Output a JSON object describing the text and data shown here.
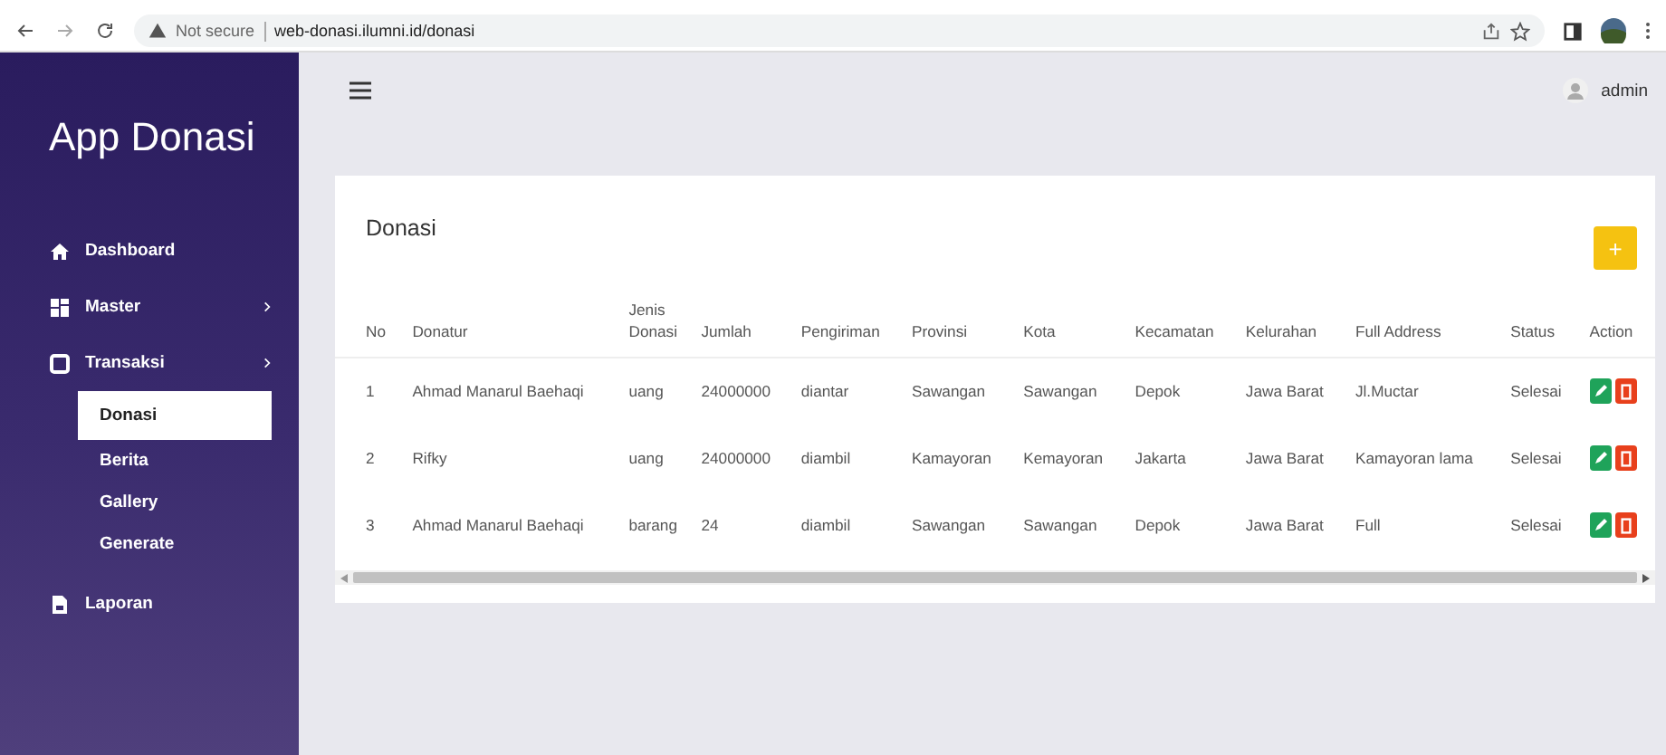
{
  "browser": {
    "security": "Not secure",
    "url": "web-donasi.ilumni.id/donasi"
  },
  "sidebar": {
    "title": "App Donasi",
    "items": [
      {
        "label": "Dashboard",
        "selected": false,
        "submenu": false
      },
      {
        "label": "Master",
        "selected": false,
        "submenu": true
      },
      {
        "label": "Transaksi",
        "selected": false,
        "submenu": true,
        "children": [
          {
            "label": "Donasi",
            "selected": true
          },
          {
            "label": "Berita",
            "selected": false
          },
          {
            "label": "Gallery",
            "selected": false
          },
          {
            "label": "Generate",
            "selected": false
          }
        ]
      },
      {
        "label": "Laporan",
        "selected": false,
        "submenu": false
      }
    ]
  },
  "topbar": {
    "user": "admin"
  },
  "card": {
    "title": "Donasi",
    "add_button": "+",
    "table": {
      "columns": [
        "No",
        "Donatur",
        "Jenis Donasi",
        "Jumlah",
        "Pengiriman",
        "Provinsi",
        "Kota",
        "Kecamatan",
        "Kelurahan",
        "Full Address",
        "Status",
        "Action"
      ],
      "rows": [
        [
          "1",
          "Ahmad Manarul Baehaqi",
          "uang",
          "24000000",
          "diantar",
          "Sawangan",
          "Sawangan",
          "Depok",
          "Jawa Barat",
          "Jl.Muctar",
          "Selesai"
        ],
        [
          "2",
          "Rifky",
          "uang",
          "24000000",
          "diambil",
          "Kamayoran",
          "Kemayoran",
          "Jakarta",
          "Jawa Barat",
          "Kamayoran lama",
          "Selesai"
        ],
        [
          "3",
          "Ahmad Manarul Baehaqi",
          "barang",
          "24",
          "diambil",
          "Sawangan",
          "Sawangan",
          "Depok",
          "Jawa Barat",
          "Full",
          "Selesai"
        ]
      ]
    }
  }
}
